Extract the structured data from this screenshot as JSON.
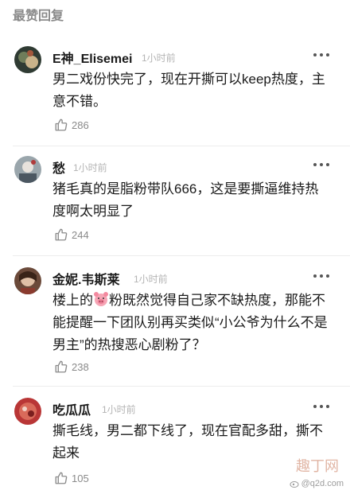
{
  "section_title": "最赞回复",
  "comments": [
    {
      "username": "E神_Elisemei",
      "time": "1小时前",
      "text": "男二戏份快完了，现在开撕可以keep热度，主意不错。",
      "likes": "286",
      "avatar_color": "#3a4a3e"
    },
    {
      "username": "愁",
      "time": "1小时前",
      "text": "猪毛真的是脂粉带队666，这是要撕逼维持热度啊太明显了",
      "likes": "244",
      "avatar_color": "#7a8b94"
    },
    {
      "username": "金妮.韦斯莱",
      "time": "1小时前",
      "text_before_icon": "楼上的",
      "pig_icon": "pig-emoji",
      "text_after_icon": "粉既然觉得自己家不缺热度，那能不能提醒一下团队别再买类似“小公爷为什么不是男主”的热搜恶心剧粉了？",
      "likes": "238",
      "avatar_color": "#5b3a2e"
    },
    {
      "username": "吃瓜瓜",
      "time": "1小时前",
      "text": "撕毛线，男二都下线了，现在官配多甜，撕不起来",
      "likes": "105",
      "avatar_color": "#a32a2a"
    }
  ],
  "watermark": {
    "text": "@q2d.com",
    "logo_text": "趣丁网"
  }
}
